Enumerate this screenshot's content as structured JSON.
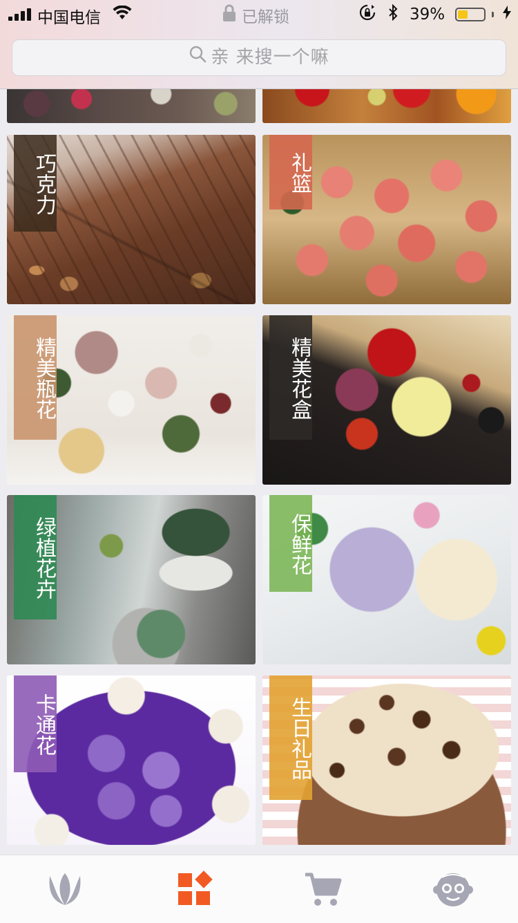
{
  "status_bar": {
    "carrier": "中国电信",
    "lock_text": "已解锁",
    "battery_percent": "39%",
    "battery_level": 0.39,
    "icons": [
      "signal-icon",
      "wifi-icon",
      "lock-icon",
      "rotation-lock-icon",
      "bluetooth-icon",
      "battery-icon",
      "charging-icon"
    ]
  },
  "search": {
    "placeholder": "亲 来搜一个嘛",
    "icon": "search-icon"
  },
  "categories": [
    {
      "label": "巧克力",
      "tag_color": "#3b2a1c"
    },
    {
      "label": "礼篮",
      "tag_color": "#d4684f"
    },
    {
      "label": "精美瓶花",
      "tag_color": "#c8936b"
    },
    {
      "label": "精美花盒",
      "tag_color": "#2e2a28"
    },
    {
      "label": "绿植花卉",
      "tag_color": "#2f8a53"
    },
    {
      "label": "保鲜花",
      "tag_color": "#7ab554"
    },
    {
      "label": "卡通花",
      "tag_color": "#8e5bb6"
    },
    {
      "label": "生日礼品",
      "tag_color": "#e2a232"
    }
  ],
  "tab_bar": {
    "items": [
      {
        "icon": "tulip-icon",
        "active": false,
        "color": "#a6a6b4"
      },
      {
        "icon": "category-blocks-icon",
        "active": true,
        "color": "#f15a22"
      },
      {
        "icon": "cart-icon",
        "active": false,
        "color": "#a6a6b4"
      },
      {
        "icon": "monkey-face-icon",
        "active": false,
        "color": "#a6a6b4"
      }
    ]
  }
}
